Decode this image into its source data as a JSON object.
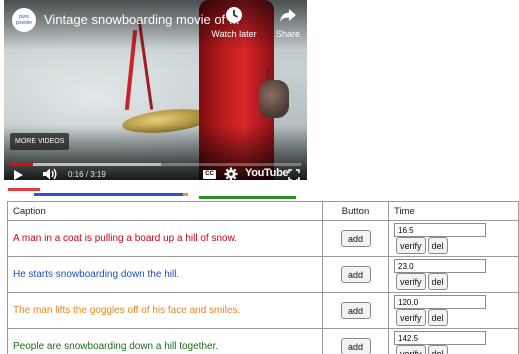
{
  "player": {
    "channel_avatar_text": "pure powder",
    "title": "Vintage snowboarding movie of ...",
    "watch_later_label": "Watch later",
    "share_label": "Share",
    "more_videos_label": "MORE VIDEOS",
    "time_display": "0:16 / 3:19",
    "cc_label": "CC",
    "youtube_logo_text": "YouTube",
    "played_fraction": 0.08,
    "buffered_fraction": 0.52,
    "icons": [
      "clock-icon",
      "share-arrow-icon",
      "play-icon",
      "volume-icon",
      "gear-icon",
      "fullscreen-icon"
    ],
    "colors": {
      "progress_played": "#ff0000"
    }
  },
  "timeline_segments": [
    {
      "color": "#e03b3b",
      "start_fraction": 0.0,
      "end_fraction": 0.11
    },
    {
      "color": "#2f56c8",
      "start_fraction": 0.09,
      "end_fraction": 0.6
    },
    {
      "color": "#f0962a",
      "start_fraction": 0.6,
      "end_fraction": 0.62
    },
    {
      "color": "#2f8a2a",
      "start_fraction": 0.655,
      "end_fraction": 0.99
    }
  ],
  "table": {
    "headers": {
      "caption": "Caption",
      "button": "Button",
      "time": "Time"
    },
    "add_label": "add",
    "verify_label": "verify",
    "del_label": "del",
    "rows": [
      {
        "caption": "A man in a coat is pulling a board up a hill of snow.",
        "color": "#d0021b",
        "time": "16.5"
      },
      {
        "caption": "He starts snowboarding down the hill.",
        "color": "#1f4fc4",
        "time": "23.0"
      },
      {
        "caption": "The man lifts the goggles off of his face and smiles.",
        "color": "#e8861e",
        "time": "120.0"
      },
      {
        "caption": "People are snowboarding down a hill together.",
        "color": "#1c6e1c",
        "time": "142.5"
      }
    ]
  }
}
